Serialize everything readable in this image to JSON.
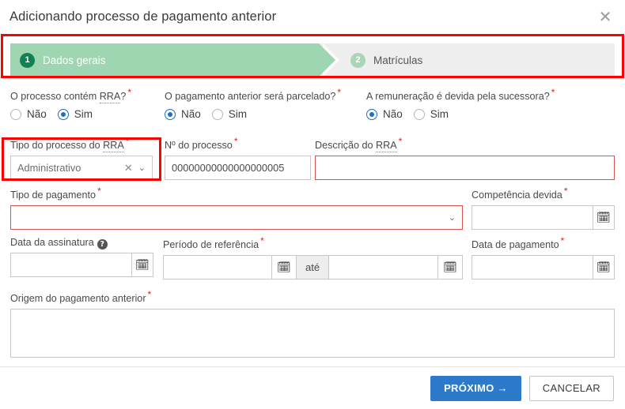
{
  "dialog": {
    "title": "Adicionando processo de pagamento anterior",
    "close_icon": "close-icon"
  },
  "stepper": {
    "steps": [
      {
        "number": "1",
        "label": "Dados gerais",
        "state": "active"
      },
      {
        "number": "2",
        "label": "Matrículas",
        "state": "inactive"
      }
    ]
  },
  "form": {
    "q_rra": {
      "label": "O processo contém ",
      "label_abbr": "RRA",
      "label_suffix": "?",
      "required": "*",
      "options": [
        {
          "label": "Não",
          "selected": false
        },
        {
          "label": "Sim",
          "selected": true
        }
      ]
    },
    "q_parcelado": {
      "label": "O pagamento anterior será parcelado?",
      "required": "*",
      "options": [
        {
          "label": "Não",
          "selected": true
        },
        {
          "label": "Sim",
          "selected": false
        }
      ]
    },
    "q_sucessora": {
      "label": "A remuneração é devida pela sucessora?",
      "required": "*",
      "options": [
        {
          "label": "Não",
          "selected": true
        },
        {
          "label": "Sim",
          "selected": false
        }
      ]
    },
    "tipo_processo_rra": {
      "label": "Tipo do processo do ",
      "label_abbr": "RRA",
      "required": "*",
      "value": "Administrativo",
      "clear_icon": "close-icon",
      "chevron_icon": "chevron-down-icon"
    },
    "numero_processo": {
      "label": "Nº do processo",
      "required": "*",
      "value": "00000000000000000005"
    },
    "descricao_rra": {
      "label": "Descrição do ",
      "label_abbr": "RRA",
      "required": "*",
      "value": "",
      "error": true
    },
    "tipo_pagamento": {
      "label": "Tipo de pagamento",
      "required": "*",
      "value": "",
      "error": true,
      "chevron_icon": "chevron-down-icon"
    },
    "competencia_devida": {
      "label": "Competência devida",
      "required": "*",
      "value": "",
      "calendar_icon": "calendar-icon"
    },
    "data_assinatura": {
      "label": "Data da assinatura",
      "help_icon": "help-icon",
      "help_glyph": "?",
      "value": "",
      "calendar_icon": "calendar-icon"
    },
    "periodo_referencia": {
      "label": "Período de referência",
      "required": "*",
      "start_value": "",
      "separator": "até",
      "end_value": "",
      "calendar_icon": "calendar-icon"
    },
    "data_pagamento": {
      "label": "Data de pagamento",
      "required": "*",
      "value": "",
      "calendar_icon": "calendar-icon"
    },
    "origem_pagamento": {
      "label": "Origem do pagamento anterior",
      "required": "*",
      "value": ""
    }
  },
  "footer": {
    "primary_label": "PRÓXIMO →",
    "cancel_label": "CANCELAR"
  },
  "colors": {
    "step_active_bg": "#9ed6b2",
    "step_badge_active": "#0e8254",
    "step_badge_inactive": "#a9d6b8",
    "step_inactive_bg": "#eeeeee",
    "radio_selected": "#1f6fc4",
    "required_star": "#e02020",
    "error_border": "#d9534f",
    "primary_button": "#2c7ac9",
    "annotation_box": "#ff0000"
  }
}
